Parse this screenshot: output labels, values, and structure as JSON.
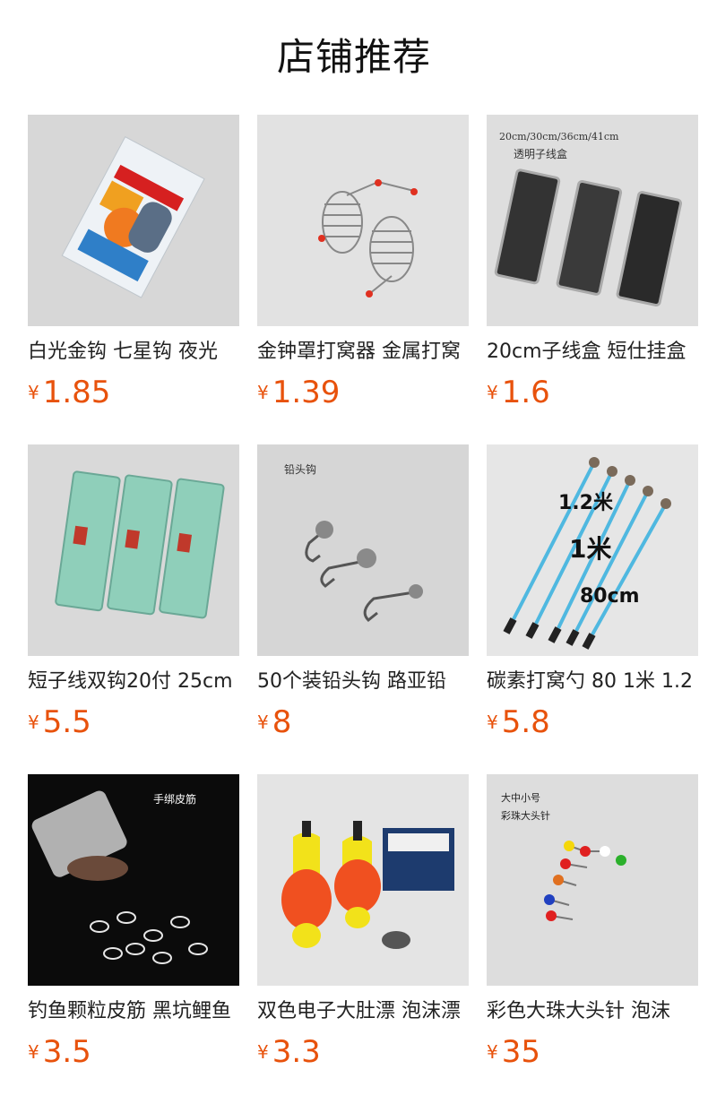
{
  "page": {
    "title": "店铺推荐"
  },
  "products": [
    {
      "name": "白光金钩 七星钩 夜光",
      "currency": "¥",
      "price": "1.85"
    },
    {
      "name": "金钟罩打窝器 金属打窝",
      "currency": "¥",
      "price": "1.39"
    },
    {
      "name": "20cm子线盒 短仕挂盒",
      "currency": "¥",
      "price": "1.6",
      "image_text": [
        "20cm/30cm/36cm/41cm",
        "透明子线盒"
      ]
    },
    {
      "name": "短子线双钩20付 25cm",
      "currency": "¥",
      "price": "5.5"
    },
    {
      "name": "50个装铅头钩 路亚铅",
      "currency": "¥",
      "price": "8",
      "image_text": [
        "铅头钩"
      ]
    },
    {
      "name": "碳素打窝勺 80 1米 1.2",
      "currency": "¥",
      "price": "5.8",
      "image_text": [
        "1.2米",
        "1米",
        "80cm"
      ]
    },
    {
      "name": "钓鱼颗粒皮筋 黑坑鲤鱼",
      "currency": "¥",
      "price": "3.5",
      "image_text": [
        "手绑皮筋"
      ]
    },
    {
      "name": "双色电子大肚漂 泡沫漂",
      "currency": "¥",
      "price": "3.3"
    },
    {
      "name": "彩色大珠大头针 泡沫",
      "currency": "¥",
      "price": "35",
      "image_text": [
        "大中小号",
        "彩珠大头针"
      ]
    }
  ]
}
